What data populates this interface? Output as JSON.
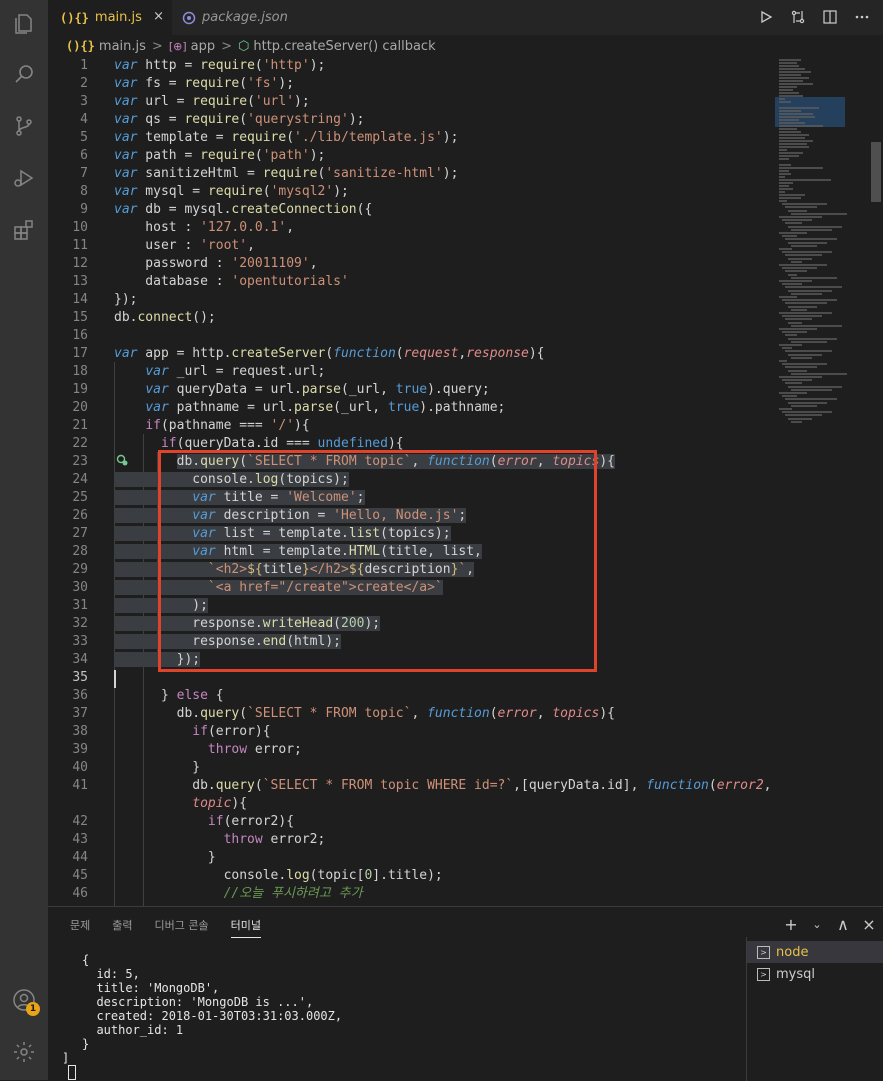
{
  "activity_bar": {
    "icons": [
      "files-icon",
      "search-icon",
      "source-control-icon",
      "run-debug-icon",
      "extensions-icon",
      "account-icon",
      "settings-gear-icon"
    ],
    "account_badge": "1"
  },
  "tabs": [
    {
      "icon": "(){}",
      "label": "main.js",
      "close": "×"
    },
    {
      "label": "package.json"
    }
  ],
  "breadcrumb": {
    "file_icon": "(){}",
    "file": "main.js",
    "sep": ">",
    "symbol1": "app",
    "symbol2": "http.createServer() callback"
  },
  "editor": {
    "line_numbers": [
      "1",
      "2",
      "3",
      "4",
      "5",
      "6",
      "7",
      "8",
      "9",
      "10",
      "11",
      "12",
      "13",
      "14",
      "15",
      "16",
      "17",
      "18",
      "19",
      "20",
      "21",
      "22",
      "23",
      "24",
      "25",
      "26",
      "27",
      "28",
      "29",
      "30",
      "31",
      "32",
      "33",
      "34",
      "35",
      "36",
      "37",
      "38",
      "39",
      "40",
      "41",
      "",
      "42",
      "43",
      "44",
      "45",
      "46"
    ],
    "current_line": "35"
  },
  "panel": {
    "tabs": [
      "문제",
      "출력",
      "디버그 콘솔",
      "터미널"
    ],
    "active_tab": "터미널",
    "actions": [
      "+",
      "⌄",
      "∧",
      "×"
    ],
    "terminal_lines": [
      "{",
      "  id: 5,",
      "  title: 'MongoDB',",
      "  description: 'MongoDB is ...',",
      "  created: 2018-01-30T03:31:03.000Z,",
      "  author_id: 1",
      "}",
      "]"
    ],
    "terminals": [
      {
        "label": "node"
      },
      {
        "label": "mysql"
      }
    ]
  }
}
